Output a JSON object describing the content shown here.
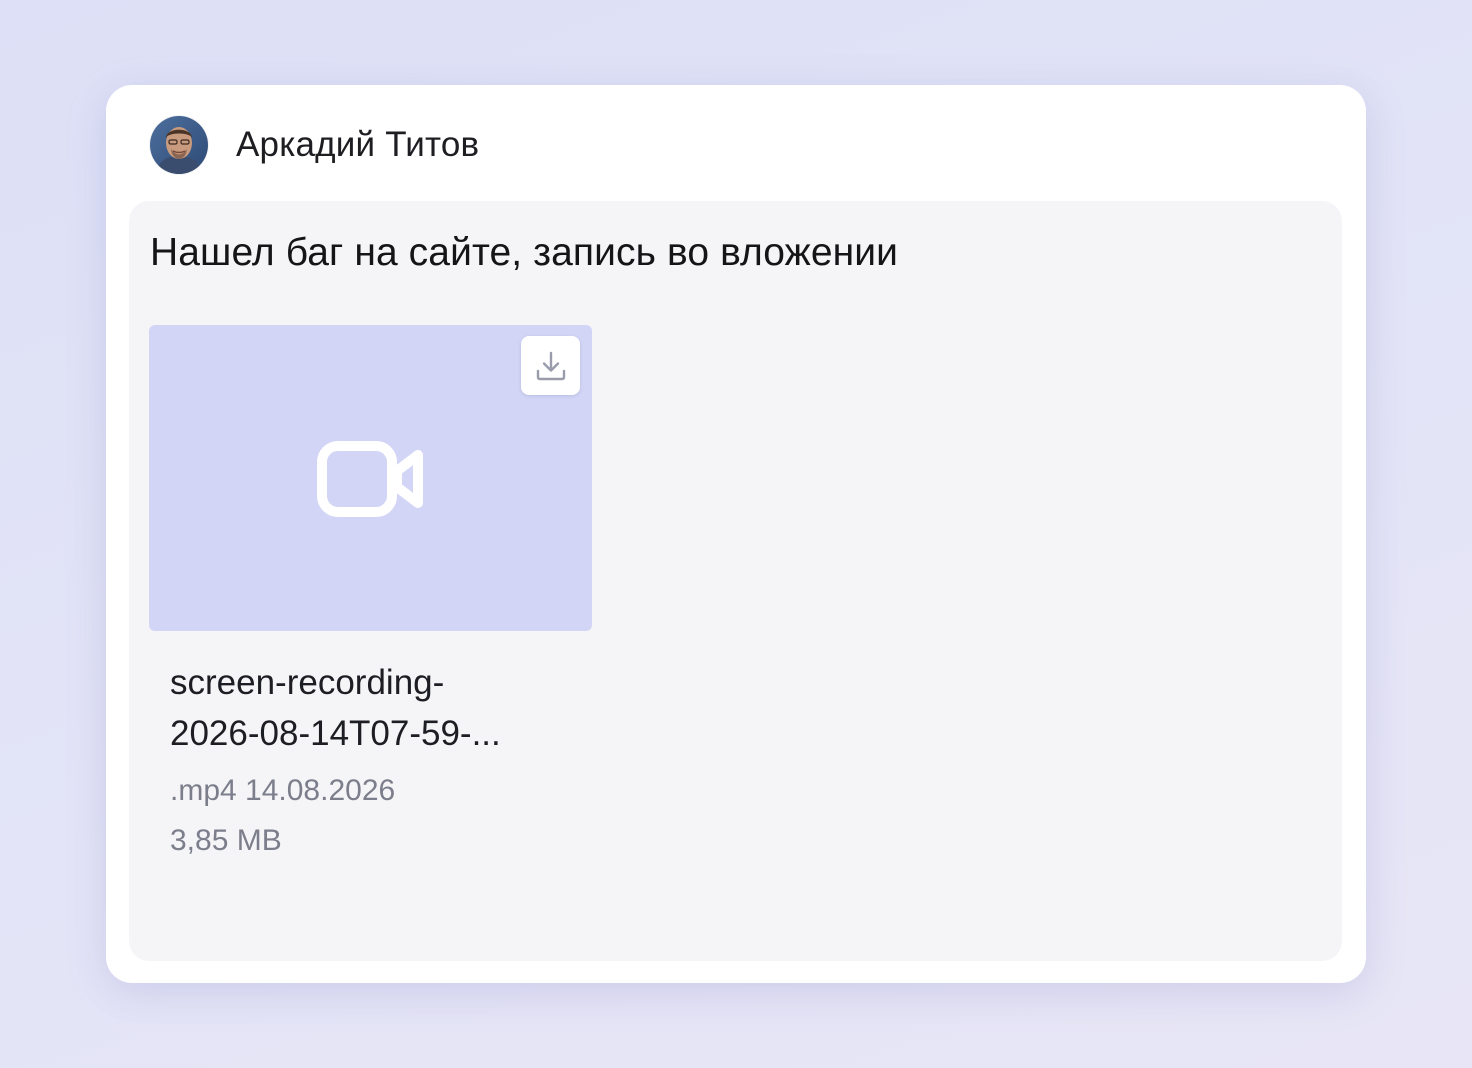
{
  "author": {
    "name": "Аркадий Титов",
    "avatar_icon": "user-avatar-photo"
  },
  "message": {
    "text": "Нашел баг на сайте, запись во вложении"
  },
  "attachment": {
    "file_name_line1": "screen-recording-",
    "file_name_line2": "2026-08-14T07-59-...",
    "extension": ".mp4",
    "date": "14.08.2026",
    "size": "3,85 MB",
    "preview_icon": "video-camera-icon",
    "download_icon": "download-icon",
    "preview_color": "#d2d5f5"
  }
}
